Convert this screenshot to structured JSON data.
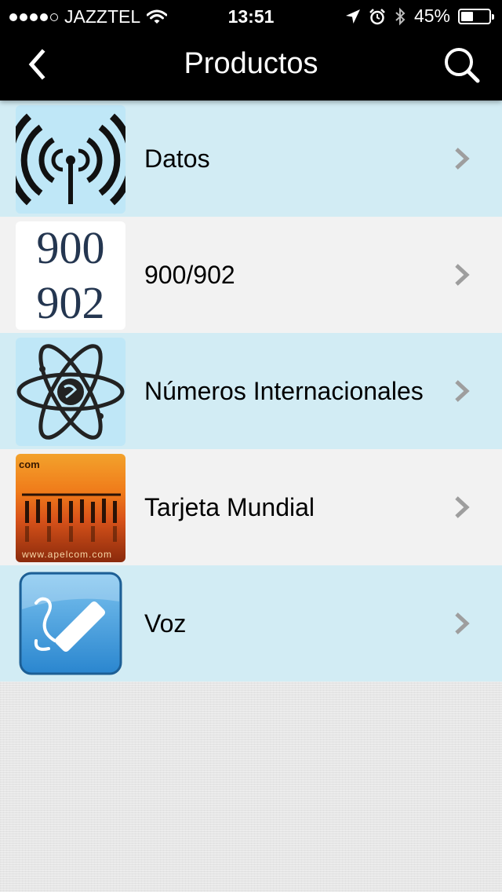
{
  "status_bar": {
    "carrier": "JAZZTEL",
    "time": "13:51",
    "battery_percent": "45%",
    "battery_level": 0.45,
    "signal_bars_filled": 4,
    "signal_bars_total": 5
  },
  "nav": {
    "title": "Productos",
    "back_icon": "chevron-left-icon",
    "search_icon": "search-icon"
  },
  "products": [
    {
      "label": "Datos",
      "icon": "antenna-icon",
      "row_color": "#d2ecf4"
    },
    {
      "label": "900/902",
      "icon": "numbers-900-902-icon",
      "icon_text_top": "900",
      "icon_text_bottom": "902",
      "row_color": "#f2f2f2"
    },
    {
      "label": "Números Internacionales",
      "icon": "atom-icon",
      "row_color": "#d2ecf4"
    },
    {
      "label": "Tarjeta Mundial",
      "icon": "apelcom-card-icon",
      "icon_text_top": "com",
      "icon_text_bottom": "www.apelcom.com",
      "row_color": "#f2f2f2"
    },
    {
      "label": "Voz",
      "icon": "phone-icon",
      "row_color": "#d2ecf4"
    }
  ],
  "colors": {
    "nav_background": "#000000",
    "row_blue": "#d2ecf4",
    "row_gray": "#f2f2f2",
    "chevron": "#9e9e9e"
  }
}
